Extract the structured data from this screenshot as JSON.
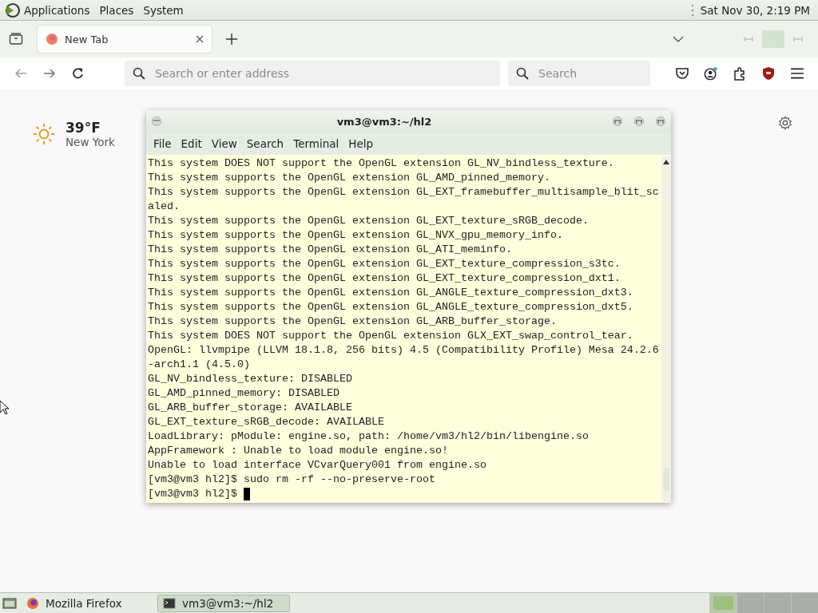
{
  "top_panel": {
    "menus": [
      "Applications",
      "Places",
      "System"
    ],
    "clock": "Sat Nov 30,  2:19 PM"
  },
  "browser": {
    "tabs": [
      {
        "label": "New Tab",
        "selected": true
      }
    ],
    "address": {
      "placeholder": "Search or enter address"
    },
    "search": {
      "placeholder": "Search"
    },
    "weather": {
      "temperature": "39°F",
      "location": "New York"
    }
  },
  "terminal": {
    "title": "vm3@vm3:~/hl2",
    "menu": [
      "File",
      "Edit",
      "View",
      "Search",
      "Terminal",
      "Help"
    ],
    "lines": [
      "This system DOES NOT support the OpenGL extension GL_NV_bindless_texture.",
      "This system supports the OpenGL extension GL_AMD_pinned_memory.",
      "This system supports the OpenGL extension GL_EXT_framebuffer_multisample_blit_scaled.",
      "This system supports the OpenGL extension GL_EXT_texture_sRGB_decode.",
      "This system supports the OpenGL extension GL_NVX_gpu_memory_info.",
      "This system supports the OpenGL extension GL_ATI_meminfo.",
      "This system supports the OpenGL extension GL_EXT_texture_compression_s3tc.",
      "This system supports the OpenGL extension GL_EXT_texture_compression_dxt1.",
      "This system supports the OpenGL extension GL_ANGLE_texture_compression_dxt3.",
      "This system supports the OpenGL extension GL_ANGLE_texture_compression_dxt5.",
      "This system supports the OpenGL extension GL_ARB_buffer_storage.",
      "This system DOES NOT support the OpenGL extension GLX_EXT_swap_control_tear.",
      "OpenGL: llvmpipe (LLVM 18.1.8, 256 bits) 4.5 (Compatibility Profile) Mesa 24.2.6-arch1.1 (4.5.0)",
      "GL_NV_bindless_texture: DISABLED",
      "GL_AMD_pinned_memory: DISABLED",
      "GL_ARB_buffer_storage: AVAILABLE",
      "GL_EXT_texture_sRGB_decode: AVAILABLE",
      "LoadLibrary: pModule: engine.so, path: /home/vm3/hl2/bin/libengine.so",
      "AppFramework : Unable to load module engine.so!",
      "Unable to load interface VCvarQuery001 from engine.so",
      "[vm3@vm3 hl2]$ sudo rm -rf --no-preserve-root"
    ],
    "prompt": "[vm3@vm3 hl2]$ "
  },
  "taskbar": {
    "tasks": [
      {
        "label": "Mozilla Firefox",
        "kind": "firefox",
        "selected": false
      },
      {
        "label": "vm3@vm3:~/hl2",
        "kind": "terminal",
        "selected": true
      }
    ],
    "workspaces": [
      {
        "selected": true
      },
      {
        "selected": false
      },
      {
        "selected": false
      },
      {
        "selected": false
      }
    ]
  }
}
